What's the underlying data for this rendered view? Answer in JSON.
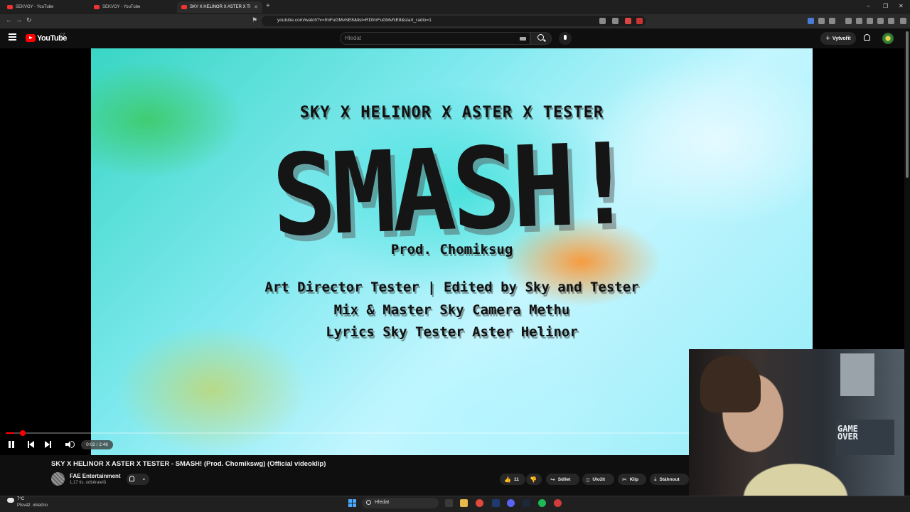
{
  "browser": {
    "tabs": [
      {
        "title": "SEKVOY - YouTube",
        "active": false
      },
      {
        "title": "SEKVOY - YouTube",
        "active": false
      },
      {
        "title": "SKY X HELINOR X ASTER X TI",
        "active": true
      }
    ],
    "url": "youtube.com/watch?v=fmFuGMvNE8&list=RDfmFuGMvNE8&start_radio=1"
  },
  "masthead": {
    "logo_text": "YouTube",
    "region": "CZ",
    "search_placeholder": "Hledat",
    "create_label": "Vytvořit"
  },
  "video": {
    "artists_line": "SKY X HELINOR X ASTER X TESTER",
    "big_title": "SMASH!",
    "prod_line": "Prod. Chomiksug",
    "credit_line_1": "Art Director Tester | Edited by Sky and Tester",
    "credit_line_2": "Mix & Master Sky  Camera Methu",
    "credit_line_3": "Lyrics Sky Tester Aster Helinor"
  },
  "player": {
    "time_display": "0:02 / 2:48",
    "progress_fraction": 0.012
  },
  "watch": {
    "title": "SKY X HELINOR X ASTER X TESTER - SMASH! (Prod. Chomikswg) (Official videoklip)",
    "channel_name": "FAE Entertainment",
    "subscribers": "1,17 tis. odběratelů",
    "like_count": "11",
    "share_label": "Sdílet",
    "save_label": "Uložit",
    "clip_label": "Klip",
    "download_label": "Stáhnout"
  },
  "webcam": {
    "shirt_text": "GAME OVER"
  },
  "taskbar": {
    "weather_temp": "7°C",
    "weather_condition": "Převáž. oblačno",
    "search_label": "Hledat"
  },
  "colors": {
    "youtube_red": "#ff0000",
    "background": "#0f0f0f"
  }
}
